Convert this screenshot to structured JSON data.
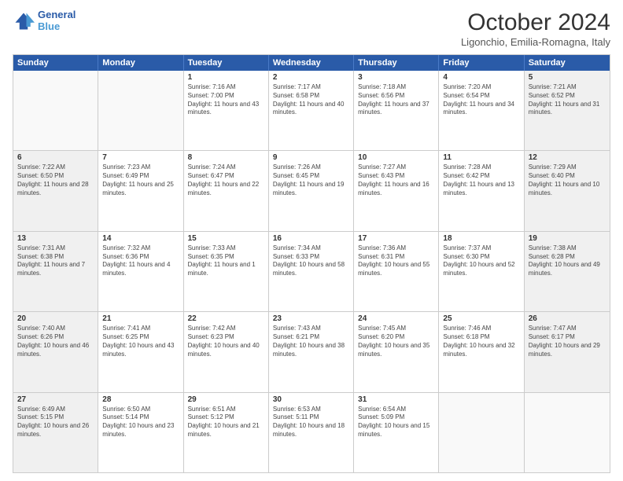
{
  "logo": {
    "line1": "General",
    "line2": "Blue"
  },
  "title": "October 2024",
  "subtitle": "Ligonchio, Emilia-Romagna, Italy",
  "header_days": [
    "Sunday",
    "Monday",
    "Tuesday",
    "Wednesday",
    "Thursday",
    "Friday",
    "Saturday"
  ],
  "rows": [
    [
      {
        "day": "",
        "sunrise": "",
        "sunset": "",
        "daylight": "",
        "shaded": false,
        "empty": true
      },
      {
        "day": "",
        "sunrise": "",
        "sunset": "",
        "daylight": "",
        "shaded": false,
        "empty": true
      },
      {
        "day": "1",
        "sunrise": "Sunrise: 7:16 AM",
        "sunset": "Sunset: 7:00 PM",
        "daylight": "Daylight: 11 hours and 43 minutes.",
        "shaded": false
      },
      {
        "day": "2",
        "sunrise": "Sunrise: 7:17 AM",
        "sunset": "Sunset: 6:58 PM",
        "daylight": "Daylight: 11 hours and 40 minutes.",
        "shaded": false
      },
      {
        "day": "3",
        "sunrise": "Sunrise: 7:18 AM",
        "sunset": "Sunset: 6:56 PM",
        "daylight": "Daylight: 11 hours and 37 minutes.",
        "shaded": false
      },
      {
        "day": "4",
        "sunrise": "Sunrise: 7:20 AM",
        "sunset": "Sunset: 6:54 PM",
        "daylight": "Daylight: 11 hours and 34 minutes.",
        "shaded": false
      },
      {
        "day": "5",
        "sunrise": "Sunrise: 7:21 AM",
        "sunset": "Sunset: 6:52 PM",
        "daylight": "Daylight: 11 hours and 31 minutes.",
        "shaded": true
      }
    ],
    [
      {
        "day": "6",
        "sunrise": "Sunrise: 7:22 AM",
        "sunset": "Sunset: 6:50 PM",
        "daylight": "Daylight: 11 hours and 28 minutes.",
        "shaded": true
      },
      {
        "day": "7",
        "sunrise": "Sunrise: 7:23 AM",
        "sunset": "Sunset: 6:49 PM",
        "daylight": "Daylight: 11 hours and 25 minutes.",
        "shaded": false
      },
      {
        "day": "8",
        "sunrise": "Sunrise: 7:24 AM",
        "sunset": "Sunset: 6:47 PM",
        "daylight": "Daylight: 11 hours and 22 minutes.",
        "shaded": false
      },
      {
        "day": "9",
        "sunrise": "Sunrise: 7:26 AM",
        "sunset": "Sunset: 6:45 PM",
        "daylight": "Daylight: 11 hours and 19 minutes.",
        "shaded": false
      },
      {
        "day": "10",
        "sunrise": "Sunrise: 7:27 AM",
        "sunset": "Sunset: 6:43 PM",
        "daylight": "Daylight: 11 hours and 16 minutes.",
        "shaded": false
      },
      {
        "day": "11",
        "sunrise": "Sunrise: 7:28 AM",
        "sunset": "Sunset: 6:42 PM",
        "daylight": "Daylight: 11 hours and 13 minutes.",
        "shaded": false
      },
      {
        "day": "12",
        "sunrise": "Sunrise: 7:29 AM",
        "sunset": "Sunset: 6:40 PM",
        "daylight": "Daylight: 11 hours and 10 minutes.",
        "shaded": true
      }
    ],
    [
      {
        "day": "13",
        "sunrise": "Sunrise: 7:31 AM",
        "sunset": "Sunset: 6:38 PM",
        "daylight": "Daylight: 11 hours and 7 minutes.",
        "shaded": true
      },
      {
        "day": "14",
        "sunrise": "Sunrise: 7:32 AM",
        "sunset": "Sunset: 6:36 PM",
        "daylight": "Daylight: 11 hours and 4 minutes.",
        "shaded": false
      },
      {
        "day": "15",
        "sunrise": "Sunrise: 7:33 AM",
        "sunset": "Sunset: 6:35 PM",
        "daylight": "Daylight: 11 hours and 1 minute.",
        "shaded": false
      },
      {
        "day": "16",
        "sunrise": "Sunrise: 7:34 AM",
        "sunset": "Sunset: 6:33 PM",
        "daylight": "Daylight: 10 hours and 58 minutes.",
        "shaded": false
      },
      {
        "day": "17",
        "sunrise": "Sunrise: 7:36 AM",
        "sunset": "Sunset: 6:31 PM",
        "daylight": "Daylight: 10 hours and 55 minutes.",
        "shaded": false
      },
      {
        "day": "18",
        "sunrise": "Sunrise: 7:37 AM",
        "sunset": "Sunset: 6:30 PM",
        "daylight": "Daylight: 10 hours and 52 minutes.",
        "shaded": false
      },
      {
        "day": "19",
        "sunrise": "Sunrise: 7:38 AM",
        "sunset": "Sunset: 6:28 PM",
        "daylight": "Daylight: 10 hours and 49 minutes.",
        "shaded": true
      }
    ],
    [
      {
        "day": "20",
        "sunrise": "Sunrise: 7:40 AM",
        "sunset": "Sunset: 6:26 PM",
        "daylight": "Daylight: 10 hours and 46 minutes.",
        "shaded": true
      },
      {
        "day": "21",
        "sunrise": "Sunrise: 7:41 AM",
        "sunset": "Sunset: 6:25 PM",
        "daylight": "Daylight: 10 hours and 43 minutes.",
        "shaded": false
      },
      {
        "day": "22",
        "sunrise": "Sunrise: 7:42 AM",
        "sunset": "Sunset: 6:23 PM",
        "daylight": "Daylight: 10 hours and 40 minutes.",
        "shaded": false
      },
      {
        "day": "23",
        "sunrise": "Sunrise: 7:43 AM",
        "sunset": "Sunset: 6:21 PM",
        "daylight": "Daylight: 10 hours and 38 minutes.",
        "shaded": false
      },
      {
        "day": "24",
        "sunrise": "Sunrise: 7:45 AM",
        "sunset": "Sunset: 6:20 PM",
        "daylight": "Daylight: 10 hours and 35 minutes.",
        "shaded": false
      },
      {
        "day": "25",
        "sunrise": "Sunrise: 7:46 AM",
        "sunset": "Sunset: 6:18 PM",
        "daylight": "Daylight: 10 hours and 32 minutes.",
        "shaded": false
      },
      {
        "day": "26",
        "sunrise": "Sunrise: 7:47 AM",
        "sunset": "Sunset: 6:17 PM",
        "daylight": "Daylight: 10 hours and 29 minutes.",
        "shaded": true
      }
    ],
    [
      {
        "day": "27",
        "sunrise": "Sunrise: 6:49 AM",
        "sunset": "Sunset: 5:15 PM",
        "daylight": "Daylight: 10 hours and 26 minutes.",
        "shaded": true
      },
      {
        "day": "28",
        "sunrise": "Sunrise: 6:50 AM",
        "sunset": "Sunset: 5:14 PM",
        "daylight": "Daylight: 10 hours and 23 minutes.",
        "shaded": false
      },
      {
        "day": "29",
        "sunrise": "Sunrise: 6:51 AM",
        "sunset": "Sunset: 5:12 PM",
        "daylight": "Daylight: 10 hours and 21 minutes.",
        "shaded": false
      },
      {
        "day": "30",
        "sunrise": "Sunrise: 6:53 AM",
        "sunset": "Sunset: 5:11 PM",
        "daylight": "Daylight: 10 hours and 18 minutes.",
        "shaded": false
      },
      {
        "day": "31",
        "sunrise": "Sunrise: 6:54 AM",
        "sunset": "Sunset: 5:09 PM",
        "daylight": "Daylight: 10 hours and 15 minutes.",
        "shaded": false
      },
      {
        "day": "",
        "sunrise": "",
        "sunset": "",
        "daylight": "",
        "shaded": false,
        "empty": true
      },
      {
        "day": "",
        "sunrise": "",
        "sunset": "",
        "daylight": "",
        "shaded": false,
        "empty": true
      }
    ]
  ]
}
